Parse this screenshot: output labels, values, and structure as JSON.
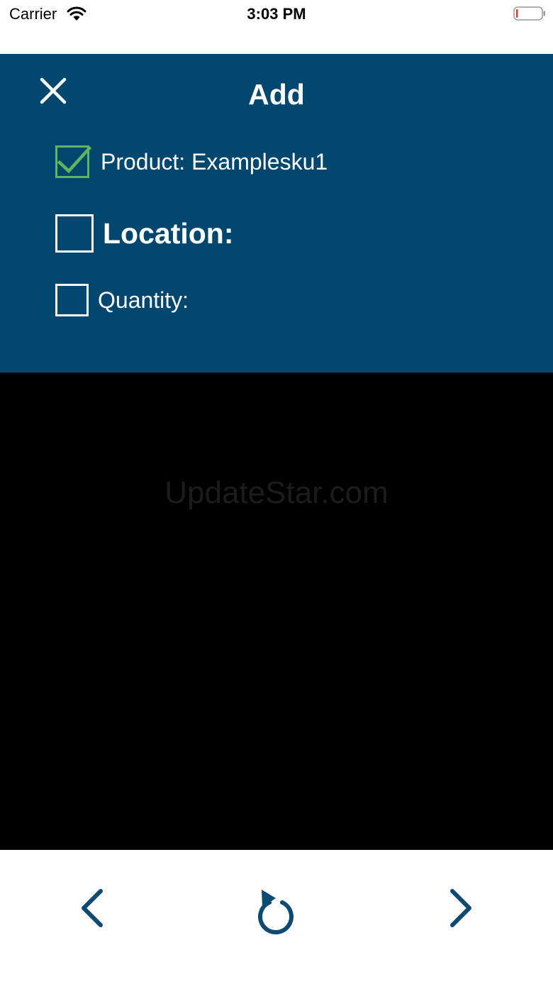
{
  "status_bar": {
    "carrier": "Carrier",
    "time": "3:03 PM",
    "battery_level": 0.05
  },
  "header": {
    "title": "Add"
  },
  "checklist": {
    "product": {
      "label": "Product: Examplesku1",
      "checked": true
    },
    "location": {
      "label": "Location:",
      "checked": false
    },
    "quantity": {
      "label": "Quantity:",
      "checked": false
    }
  },
  "scanner": {
    "watermark": "UpdateStar.com"
  },
  "toolbar": {
    "prev_icon": "chevron-left-icon",
    "refresh_icon": "refresh-icon",
    "next_icon": "chevron-right-icon"
  },
  "colors": {
    "panel": "#00476f",
    "accent": "#0a4a73",
    "checked": "#5cb85c",
    "battery_low": "#e53935"
  }
}
